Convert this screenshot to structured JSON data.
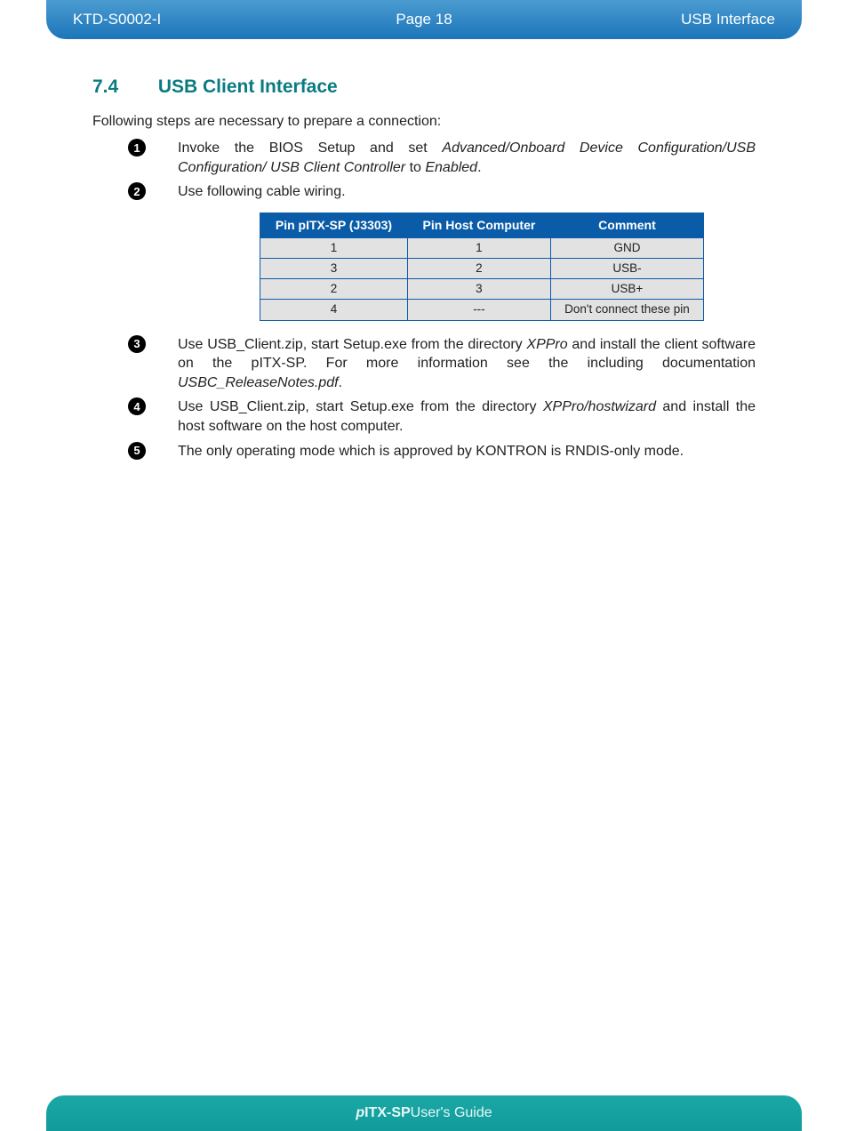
{
  "header": {
    "doc_code": "KTD-S0002-I",
    "page_label": "Page 18",
    "section_title": "USB Interface"
  },
  "section": {
    "number": "7.4",
    "title": "USB Client Interface"
  },
  "intro": "Following steps are necessary to prepare a connection:",
  "steps": {
    "s1_pre": "Invoke the BIOS Setup and set ",
    "s1_path": "Advanced/Onboard Device Configuration/USB Configuration/ USB Client Controller",
    "s1_mid": " to ",
    "s1_enabled": "Enabled",
    "s1_post": ".",
    "s2": "Use following cable wiring.",
    "s3_pre": "Use USB_Client.zip, start Setup.exe from the directory ",
    "s3_dir": "XPPro",
    "s3_mid": " and install the client software on the pITX-SP. For more information see the including documentation ",
    "s3_doc": "USBC_ReleaseNotes.pdf",
    "s3_post": ".",
    "s4_pre": "Use USB_Client.zip, start Setup.exe from the directory ",
    "s4_dir": "XPPro/hostwizard",
    "s4_post": " and install the host software on the host computer.",
    "s5": "The only operating mode which is approved by KONTRON is RNDIS-only mode."
  },
  "table": {
    "headers": [
      "Pin pITX-SP (J3303)",
      "Pin Host Computer",
      "Comment"
    ],
    "rows": [
      [
        "1",
        "1",
        "GND"
      ],
      [
        "3",
        "2",
        "USB-"
      ],
      [
        "2",
        "3",
        "USB+"
      ],
      [
        "4",
        "---",
        "Don't connect these pin"
      ]
    ]
  },
  "footer": {
    "prefix_ital": "p",
    "prefix_bold": "ITX-SP",
    "rest": " User's Guide"
  }
}
